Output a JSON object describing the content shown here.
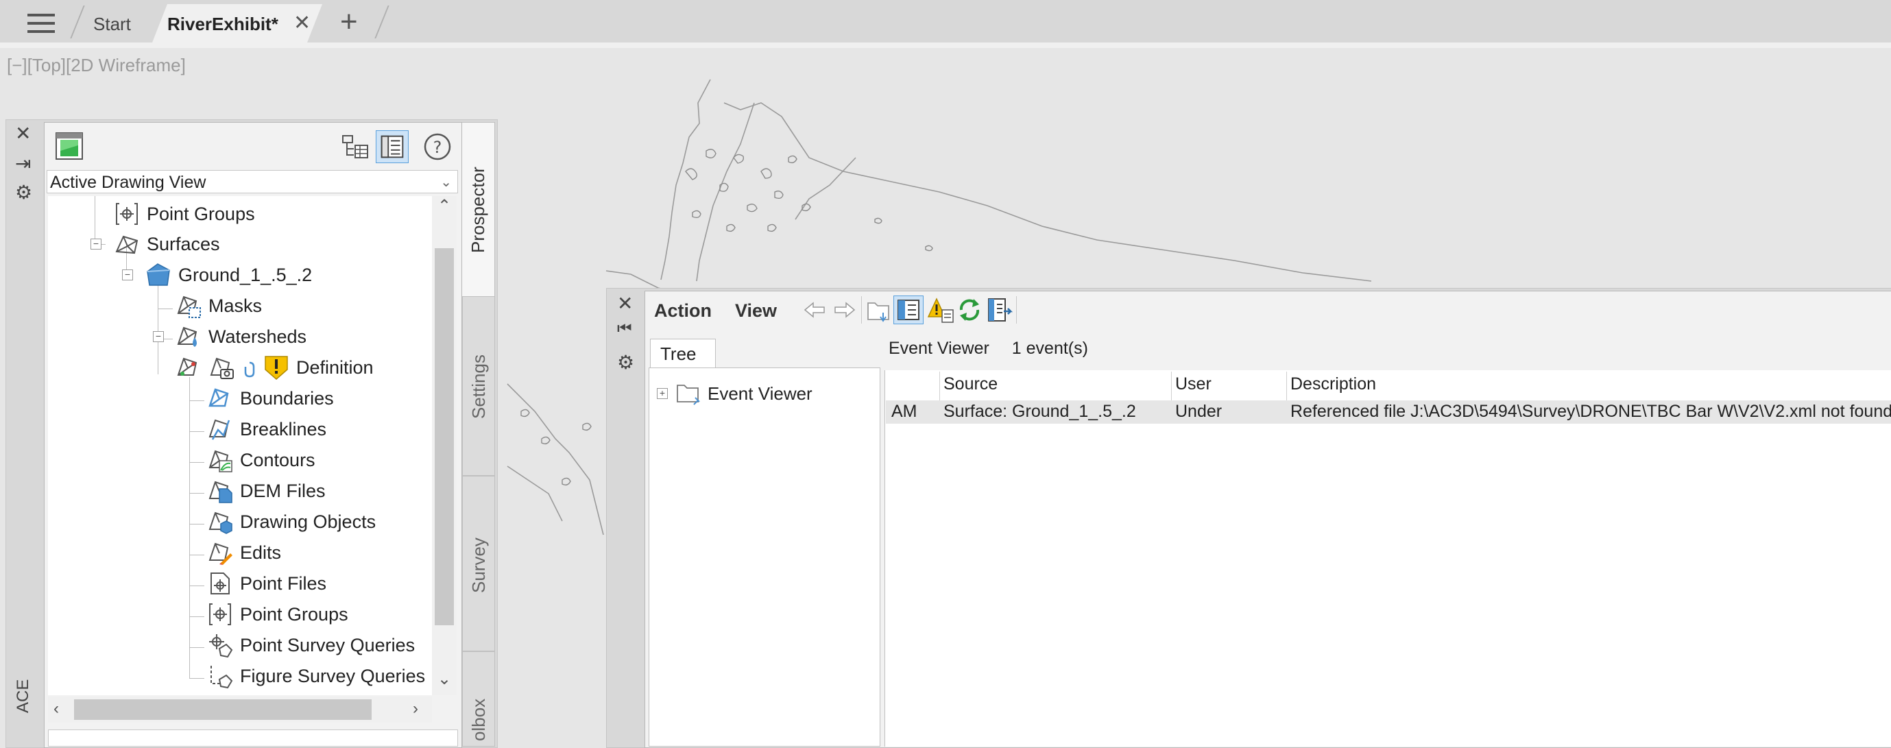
{
  "tabs": {
    "menu_icon": "hamburger-icon",
    "start": "Start",
    "active": "RiverExhibit*",
    "close_glyph": "✕",
    "new_glyph": "+"
  },
  "viewport": {
    "label": "[−][Top][2D Wireframe]"
  },
  "left_strip": {
    "close": "✕",
    "dock": "⇥",
    "settings": "⚙",
    "vertical_label": "ACE"
  },
  "prospector": {
    "view_dropdown": "Active Drawing View",
    "tree": [
      {
        "label": "Point Groups",
        "icon": "point-groups-icon"
      },
      {
        "label": "Surfaces",
        "icon": "surfaces-icon"
      },
      {
        "label": "Ground_1_.5_.2",
        "icon": "surface-icon"
      },
      {
        "label": "Masks",
        "icon": "masks-icon"
      },
      {
        "label": "Watersheds",
        "icon": "watersheds-icon"
      },
      {
        "label": "Definition",
        "icon": "definition-icon"
      },
      {
        "label": "Boundaries",
        "icon": "boundaries-icon"
      },
      {
        "label": "Breaklines",
        "icon": "breaklines-icon"
      },
      {
        "label": "Contours",
        "icon": "contours-icon"
      },
      {
        "label": "DEM Files",
        "icon": "dem-files-icon"
      },
      {
        "label": "Drawing Objects",
        "icon": "drawing-objects-icon"
      },
      {
        "label": "Edits",
        "icon": "edits-icon"
      },
      {
        "label": "Point Files",
        "icon": "point-files-icon"
      },
      {
        "label": "Point Groups",
        "icon": "point-groups-icon"
      },
      {
        "label": "Point Survey Queries",
        "icon": "point-survey-queries-icon"
      },
      {
        "label": "Figure Survey Queries",
        "icon": "figure-survey-queries-icon"
      }
    ],
    "side_tabs": [
      "Prospector",
      "Settings",
      "Survey",
      "olbox"
    ]
  },
  "event_viewer": {
    "menu": {
      "action": "Action",
      "view": "View"
    },
    "tree_tab": "Tree",
    "tree_item": "Event Viewer",
    "header_title": "Event Viewer",
    "header_count": "1 event(s)",
    "columns": [
      "Source",
      "User",
      "Description"
    ],
    "rows": [
      {
        "time": "AM",
        "source": "Surface: Ground_1_.5_.2",
        "user": "Under",
        "description": "Referenced file J:\\AC3D\\5494\\Survey\\DRONE\\TBC Bar W\\V2\\V2.xml not found"
      }
    ]
  },
  "colors": {
    "accent": "#4a90d0",
    "warning": "#f5c000",
    "refresh": "#2a9a3a"
  }
}
